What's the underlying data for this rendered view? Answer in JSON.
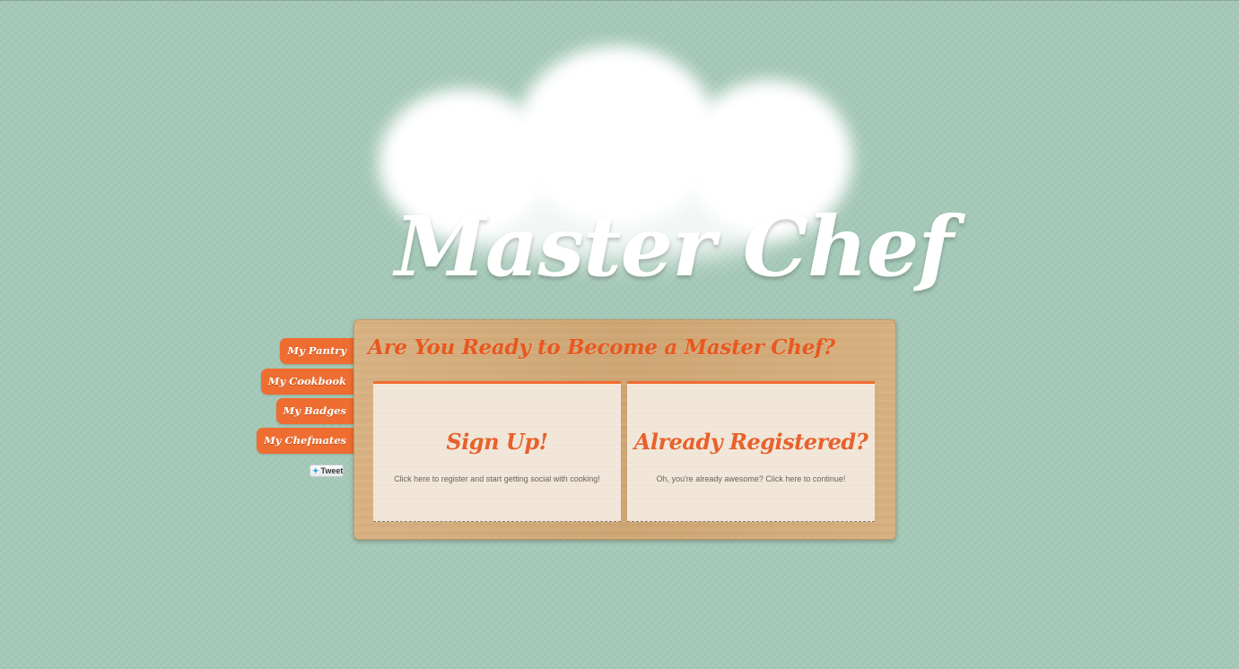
{
  "brand": {
    "title": "Master Chef",
    "logo_icon": "chef-hat-icon"
  },
  "sidenav": {
    "items": [
      {
        "label": "My Pantry"
      },
      {
        "label": "My Cookbook"
      },
      {
        "label": "My Badges"
      },
      {
        "label": "My Chefmates"
      }
    ],
    "tweet": {
      "label": "Tweet",
      "icon": "twitter-bird-icon"
    }
  },
  "main": {
    "title": "Are You Ready to Become a Master Chef?",
    "cards": [
      {
        "heading": "Sign Up!",
        "description": "Click here to register and start getting social with cooking!"
      },
      {
        "heading": "Already Registered?",
        "description": "Oh, you're already awesome? Click here to continue!"
      }
    ]
  },
  "colors": {
    "background": "#a5c9b8",
    "accent": "#ef6d30",
    "title_orange": "#e8581f",
    "wood": "#d4ab78",
    "card": "#f0e5d7"
  }
}
